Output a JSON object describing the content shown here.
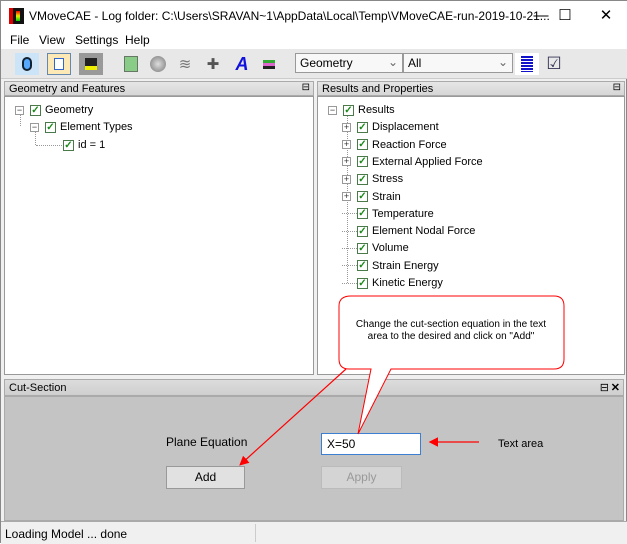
{
  "window": {
    "title": "VMoveCAE - Log folder: C:\\Users\\SRAVAN~1\\AppData\\Local\\Temp\\VMoveCAE-run-2019-10-21...",
    "minimize": "—",
    "maximize": "☐",
    "close": "✕"
  },
  "menu": {
    "items": [
      "File",
      "View",
      "Settings",
      "Help"
    ]
  },
  "toolbar": {
    "icons": [
      "open-icon",
      "copy-icon",
      "save-icon",
      "geometry-box-icon",
      "disc-icon",
      "waves-icon",
      "layers-add-icon",
      "text-icon",
      "stack-icon",
      "list-icon",
      "checkbox-icon"
    ],
    "text_icon_glyph": "A",
    "dropdown1": "Geometry",
    "dropdown2": "All"
  },
  "left_panel": {
    "title": "Geometry and Features",
    "tree": [
      {
        "label": "Geometry",
        "checked": true
      },
      {
        "label": "Element Types",
        "checked": true
      },
      {
        "label": "id = 1",
        "checked": true
      }
    ]
  },
  "right_panel": {
    "title": "Results and Properties",
    "root": "Results",
    "items": [
      {
        "label": "Displacement",
        "expandable": true
      },
      {
        "label": "Reaction Force",
        "expandable": true
      },
      {
        "label": "External Applied Force",
        "expandable": true
      },
      {
        "label": "Stress",
        "expandable": true
      },
      {
        "label": "Strain",
        "expandable": true
      },
      {
        "label": "Temperature",
        "expandable": false
      },
      {
        "label": "Element Nodal Force",
        "expandable": false
      },
      {
        "label": "Volume",
        "expandable": false
      },
      {
        "label": "Strain Energy",
        "expandable": false
      },
      {
        "label": "Kinetic Energy",
        "expandable": false
      }
    ]
  },
  "cut_section": {
    "title": "Cut-Section",
    "plane_label": "Plane Equation",
    "equation_value": "X=50",
    "add_label": "Add",
    "apply_label": "Apply"
  },
  "annotations": {
    "callout": "Change the cut-section equation in the text area to the desired and click on \"Add\"",
    "text_area_label": "Text area",
    "color": "#ff0000"
  },
  "status": {
    "text": "Loading Model ... done"
  }
}
